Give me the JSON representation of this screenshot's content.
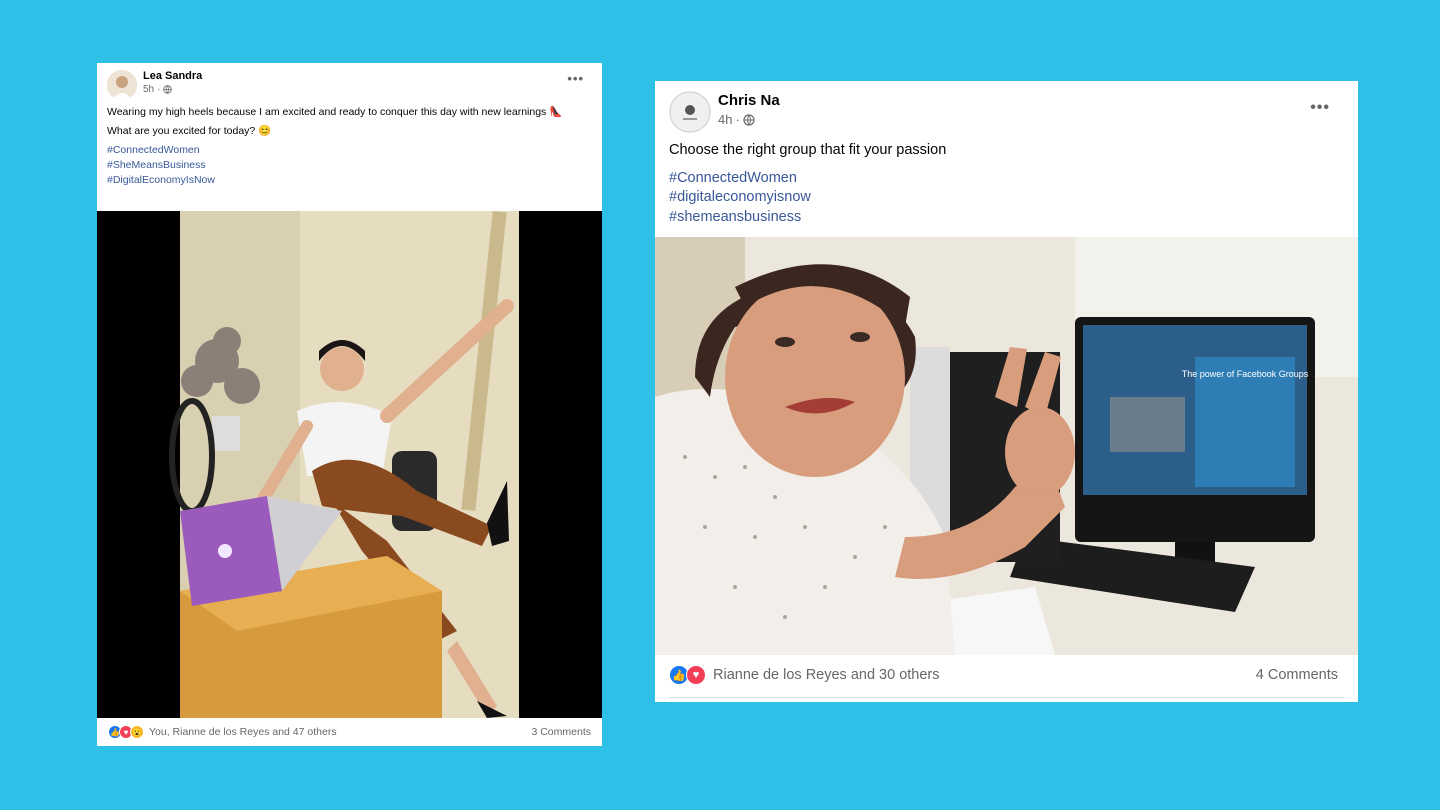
{
  "post1": {
    "author": "Lea Sandra",
    "time": "5h",
    "privacy_icon": "globe-icon",
    "body": [
      "Wearing my high heels because I am excited and ready to conquer this day with new learnings 👠",
      "What are you excited for today? 😊"
    ],
    "hashtags": [
      "#ConnectedWomen",
      "#SheMeansBusiness",
      "#DigitalEconomyIsNow"
    ],
    "reactions": [
      "like",
      "love",
      "wow"
    ],
    "reaction_names": "You, Rianne de los Reyes and 47 others",
    "comments": "3 Comments"
  },
  "post2": {
    "author": "Chris Na",
    "time": "4h",
    "privacy_icon": "globe-icon",
    "body": [
      "Choose the right group that fit your passion"
    ],
    "hashtags": [
      "#ConnectedWomen",
      "#digitaleconomyisnow",
      "#shemeansbusiness"
    ],
    "reactions": [
      "like",
      "love"
    ],
    "reaction_names": "Rianne de los Reyes and 30 others",
    "comments": "4 Comments",
    "screen_text": "The power of Facebook Groups"
  },
  "colors": {
    "background": "#2ec0e6",
    "link": "#385898",
    "like": "#1877f2",
    "love": "#f33e58",
    "wow": "#f7b928"
  }
}
